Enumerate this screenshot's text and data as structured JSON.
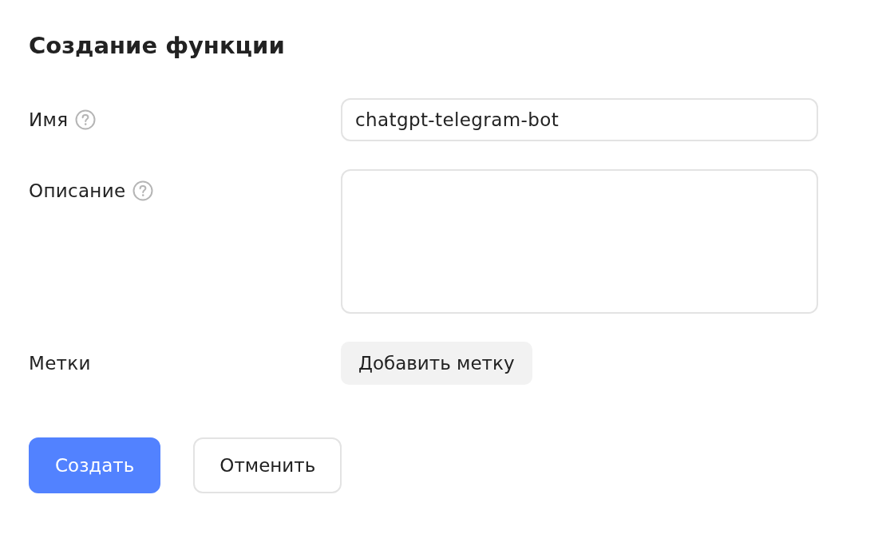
{
  "title": "Создание функции",
  "fields": [
    {
      "kind": "input",
      "label": "Имя",
      "help": true,
      "value": "chatgpt-telegram-bot"
    },
    {
      "kind": "textarea",
      "label": "Описание",
      "help": true
    },
    {
      "kind": "button",
      "label": "Метки",
      "help": false,
      "button": "Добавить метку"
    }
  ],
  "actions": [
    {
      "kind": "primary",
      "label": "Создать"
    },
    {
      "kind": "secondary",
      "label": "Отменить"
    }
  ]
}
